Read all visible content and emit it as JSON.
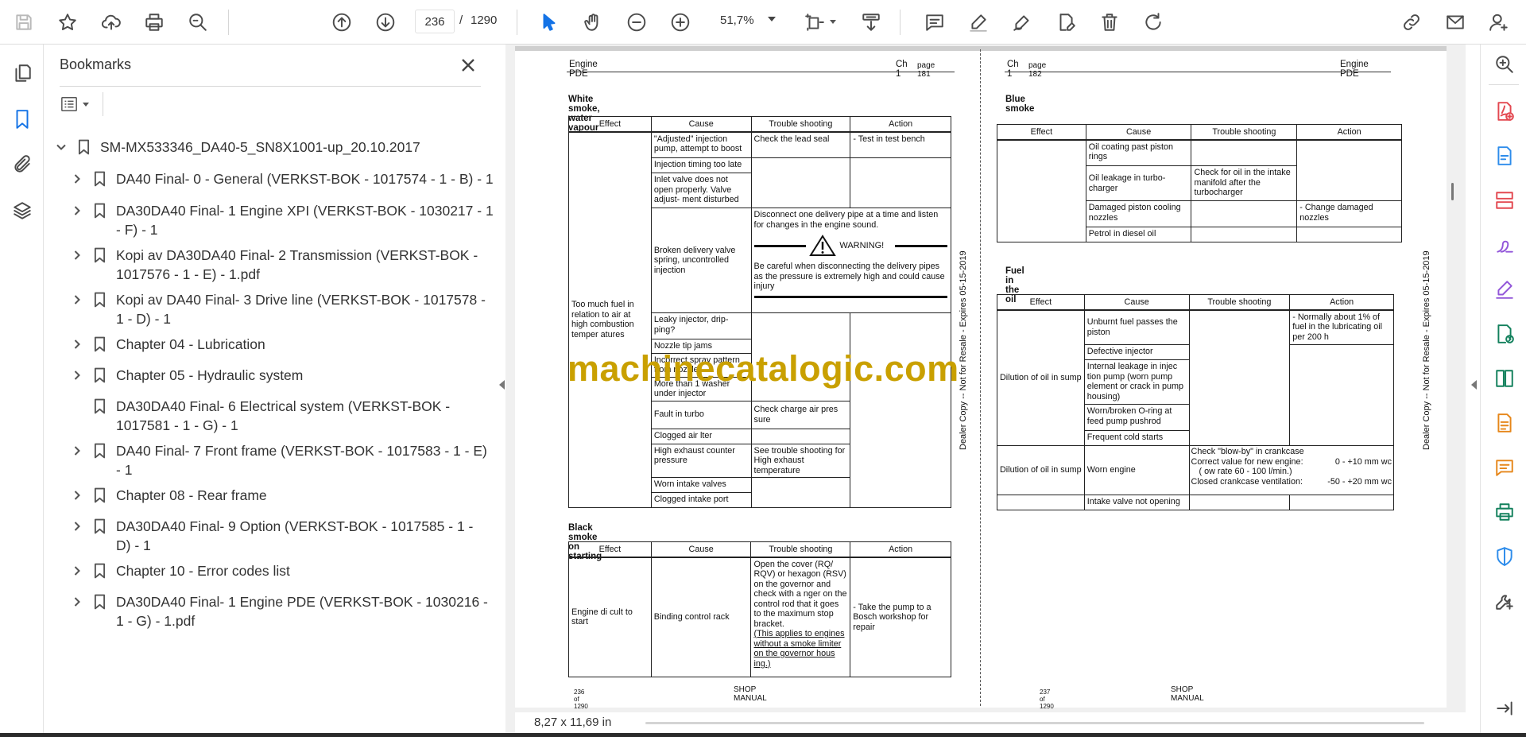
{
  "toolbar": {
    "page_current": "236",
    "page_separator": "/",
    "page_total": "1290",
    "zoom": "51,7%"
  },
  "bookmarks": {
    "title": "Bookmarks",
    "items": [
      {
        "label": "SM-MX533346_DA40-5_SN8X1001-up_20.10.2017",
        "expanded": true
      },
      {
        "label": "DA40 Final- 0 - General (VERKST-BOK - 1017574 - 1 - B) - 1"
      },
      {
        "label": "DA30DA40 Final- 1 Engine XPI (VERKST-BOK - 1030217 - 1 - F) - 1"
      },
      {
        "label": "Kopi av DA30DA40 Final- 2 Transmission (VERKST-BOK - 1017576 - 1 - E) - 1.pdf"
      },
      {
        "label": "Kopi av DA40 Final- 3 Drive line (VERKST-BOK - 1017578 - 1 - D) - 1"
      },
      {
        "label": "Chapter 04 - Lubrication"
      },
      {
        "label": "Chapter 05 - Hydraulic system"
      },
      {
        "label": "DA30DA40 Final- 6 Electrical system (VERKST-BOK - 1017581 - 1 - G) - 1"
      },
      {
        "label": "DA40 Final- 7 Front frame (VERKST-BOK - 1017583 - 1 - E) - 1"
      },
      {
        "label": "Chapter 08 - Rear frame"
      },
      {
        "label": "DA30DA40 Final- 9 Option (VERKST-BOK - 1017585 - 1 - D) - 1"
      },
      {
        "label": "Chapter 10 - Error codes list"
      },
      {
        "label": "DA30DA40 Final- 1 Engine PDE (VERKST-BOK - 1030216 - 1 - G) - 1.pdf"
      }
    ]
  },
  "status": {
    "page_size": "8,27 x 11,69 in"
  },
  "watermark": "machinecatalogic.com",
  "left_page": {
    "header_left": "Engine PDE",
    "header_right_ch": "Ch 1",
    "header_right_page": "page 181",
    "vertical_mark": "Dealer Copy -- Not for Resale - Expires 05-15-2019",
    "section1_title": "White smoke, water vapour",
    "columns": [
      "Effect",
      "Cause",
      "Trouble shooting",
      "Action"
    ],
    "t1": {
      "effect": "Too much fuel in relation to air at high combustion temper atures",
      "c1": "\"Adjusted\" injection pump, attempt to boost",
      "ts1": "Check the lead seal",
      "a1": "- Test in test bench",
      "c2": "Injection timing too late",
      "c3": "Inlet valve does not open properly. Valve adjust- ment disturbed",
      "c4": "Broken delivery valve spring, uncontrolled injection",
      "ts4a": "Disconnect one delivery pipe at a time and listen for changes in the engine sound.",
      "warning": "WARNING!",
      "ts4b": "Be careful when disconnecting the delivery pipes as the pressure is extremely high and could cause injury",
      "c5": "Leaky injector, drip- ping?",
      "c6": "Nozzle tip jams",
      "c7": "Incorrect spray pattern from nozzle",
      "c8": "More than 1 washer under injector",
      "c9": "Fault in turbo",
      "ts9": "Check charge air pres sure",
      "c10": "Clogged air    lter",
      "c11": "High exhaust counter pressure",
      "ts11": "See trouble shooting for High exhaust temperature",
      "c12": "Worn intake valves",
      "c13": "Clogged intake port"
    },
    "section2_title": "Black smoke on starting",
    "t2": {
      "effect": "Engine di    cult to start",
      "cause": "Binding control rack",
      "ts_a": "Open the cover (RQ/ RQV) or hexagon (RSV) on the governor and check with a    nger on the control rod that it goes to the maximum stop bracket.",
      "ts_b": "(This applies to engines without a smoke limiter on the governor hous ing.)",
      "action": "- Take the pump to a Bosch workshop for repair"
    },
    "footer_page": "236 of 1290",
    "footer_center": "SHOP MANUAL"
  },
  "right_page": {
    "header_left_ch": "Ch 1",
    "header_left_page": "page 182",
    "header_right": "Engine PDE",
    "vertical_mark": "Dealer Copy -- Not for Resale - Expires 05-15-2019",
    "section1_title": "Blue smoke",
    "columns": [
      "Effect",
      "Cause",
      "Trouble shooting",
      "Action"
    ],
    "t1": {
      "c1": "Oil coating past piston rings",
      "c2": "Oil leakage in turbo- charger",
      "ts2": "Check for oil in the intake manifold after the turbocharger",
      "c3": "Damaged piston cooling nozzles",
      "a3": "- Change damaged nozzles",
      "c4": "Petrol in diesel oil"
    },
    "section2_title": "Fuel in the oil",
    "t2": {
      "effect1": "Dilution of oil in sump",
      "c1": "Unburnt fuel passes the piston",
      "a1": "- Normally about 1% of fuel in the lubricating oil per 200 h",
      "c2": "Defective injector",
      "c3": "Internal leakage in injec tion pump (worn pump element or crack in pump housing)",
      "c4": "Worn/broken O-ring at feed pump pushrod",
      "c5": "Frequent cold starts",
      "effect2": "Dilution of oil in sump",
      "c6": "Worn engine",
      "ts6a": "Check \"blow-by\" in crankcase",
      "ts6b": "Correct value for new engine:",
      "ts6b_val": "0 - +10 mm wc",
      "ts6c": "(    ow rate 60 - 100 l/min.)",
      "ts6d": "Closed crankcase ventilation:",
      "ts6d_val": "-50 - +20 mm wc",
      "c7": "Intake valve not opening"
    },
    "footer_page": "237 of 1290",
    "footer_center": "SHOP MANUAL"
  }
}
